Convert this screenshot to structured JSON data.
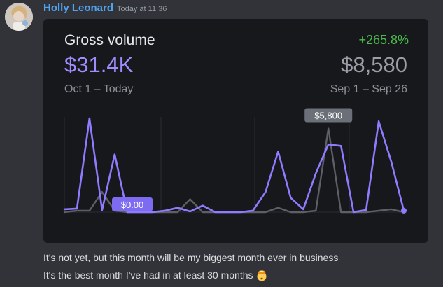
{
  "message": {
    "author": "Holly Leonard",
    "timestamp": "Today at 11:36",
    "lines": [
      "It's not yet, but this month will be my biggest month ever in business",
      "It's the best month I've had in at least 30 months"
    ],
    "emoji": "exploding-head"
  },
  "card": {
    "title": "Gross volume",
    "change": "+265.8%",
    "current_value": "$31.4K",
    "previous_value": "$8,580",
    "current_range": "Oct 1 – Today",
    "previous_range": "Sep 1 – Sep 26"
  },
  "colors": {
    "current": "#8f7bff",
    "previous": "#5c5f66",
    "change_positive": "#4bbd4b",
    "author": "#4fa3f0"
  },
  "chart_data": {
    "type": "line",
    "series": [
      {
        "key": "current",
        "values": [
          200,
          250,
          6500,
          150,
          4000,
          0,
          0,
          0,
          100,
          300,
          50,
          450,
          0,
          0,
          0,
          100,
          1400,
          4200,
          1000,
          200,
          2700,
          4700,
          4600,
          0,
          150,
          6300,
          3500,
          100
        ]
      },
      {
        "key": "previous",
        "values": [
          0,
          100,
          100,
          1400,
          100,
          0,
          0,
          0,
          0,
          0,
          900,
          0,
          0,
          0,
          0,
          0,
          0,
          300,
          0,
          0,
          100,
          5800,
          0,
          0,
          0,
          100,
          200,
          0
        ]
      }
    ],
    "markers": [
      {
        "series": "current",
        "index": 4,
        "label": "$0.00"
      },
      {
        "series": "previous",
        "index": 21,
        "label": "$5,800"
      }
    ],
    "ylim": [
      0,
      6700
    ],
    "grid": "vertical"
  }
}
